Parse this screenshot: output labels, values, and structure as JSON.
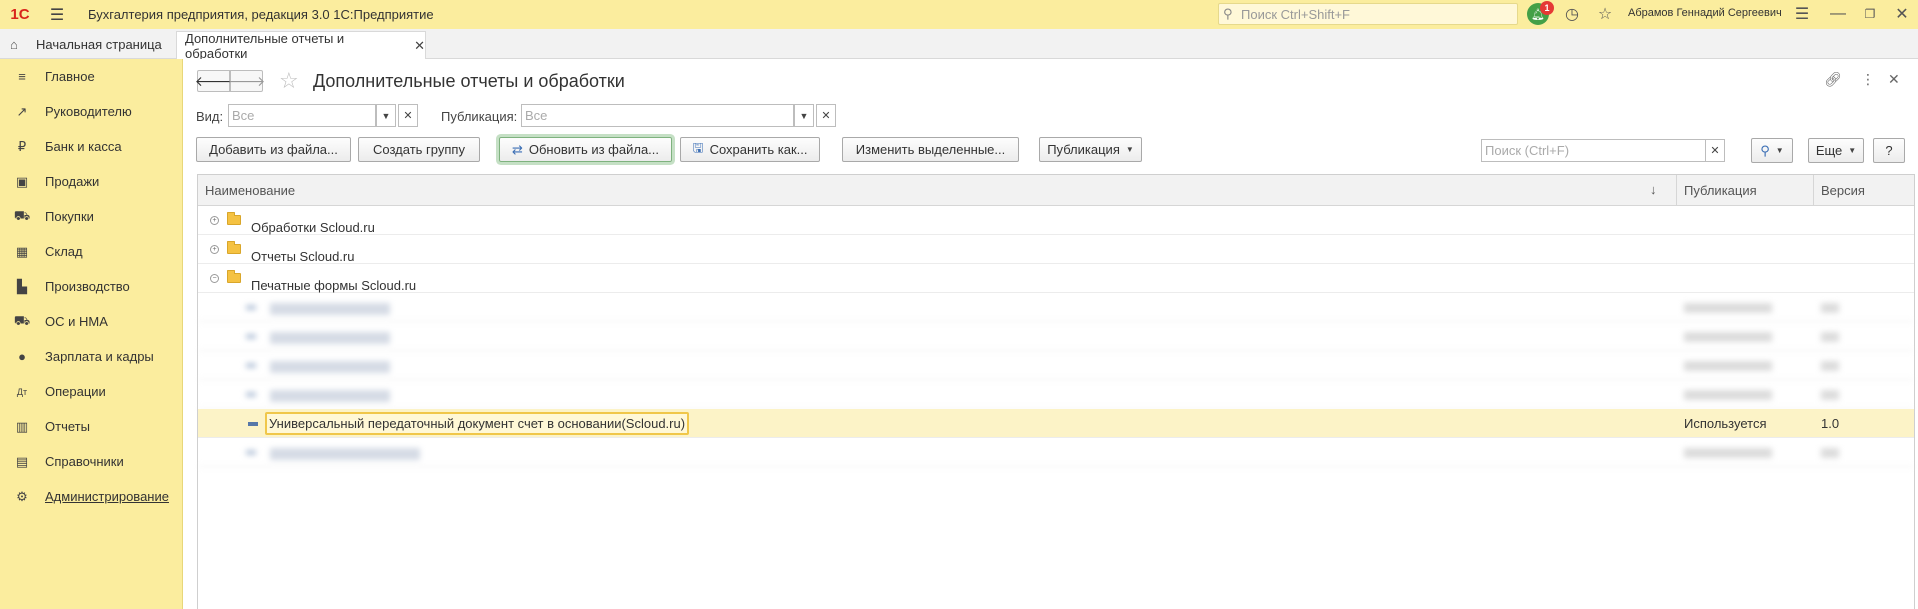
{
  "titlebar": {
    "logo": "1С",
    "app_title": "Бухгалтерия предприятия, редакция 3.0 1С:Предприятие",
    "search_placeholder": "Поиск Ctrl+Shift+F",
    "notifications_count": "1",
    "user_name": "Абрамов Геннадий Сергеевич"
  },
  "tabs": {
    "home": "Начальная страница",
    "active": "Дополнительные отчеты и обработки"
  },
  "sidebar": {
    "items": [
      {
        "label": "Главное",
        "icon": "menu-lines-icon"
      },
      {
        "label": "Руководителю",
        "icon": "trend-icon"
      },
      {
        "label": "Банк и касса",
        "icon": "ruble-coin-icon"
      },
      {
        "label": "Продажи",
        "icon": "shopping-bag-icon"
      },
      {
        "label": "Покупки",
        "icon": "cart-icon"
      },
      {
        "label": "Склад",
        "icon": "warehouse-icon"
      },
      {
        "label": "Производство",
        "icon": "factory-icon"
      },
      {
        "label": "ОС и НМА",
        "icon": "truck-icon"
      },
      {
        "label": "Зарплата и кадры",
        "icon": "person-icon"
      },
      {
        "label": "Операции",
        "icon": "dt-kt-icon"
      },
      {
        "label": "Отчеты",
        "icon": "bar-chart-icon"
      },
      {
        "label": "Справочники",
        "icon": "books-icon"
      },
      {
        "label": "Администрирование",
        "icon": "gear-icon"
      }
    ]
  },
  "page": {
    "title": "Дополнительные отчеты и обработки",
    "filters": {
      "kind_label": "Вид:",
      "kind_placeholder": "Все",
      "publication_label": "Публикация:",
      "publication_placeholder": "Все"
    },
    "toolbar": {
      "add_from_file": "Добавить из файла...",
      "create_group": "Создать группу",
      "update_from_file": "Обновить из файла...",
      "save_as": "Сохранить как...",
      "change_selected": "Изменить выделенные...",
      "publication": "Публикация",
      "search_placeholder": "Поиск (Ctrl+F)",
      "more": "Еще",
      "help": "?"
    },
    "table": {
      "columns": {
        "name": "Наименование",
        "publication": "Публикация",
        "version": "Версия"
      },
      "groups": [
        {
          "name": "Обработки Scloud.ru",
          "expander": "+"
        },
        {
          "name": "Отчеты Scloud.ru",
          "expander": "+"
        },
        {
          "name": "Печатные формы Scloud.ru",
          "expander": "−"
        }
      ],
      "selected_row": {
        "name": "Универсальный передаточный документ счет в основании(Scloud.ru)",
        "publication": "Используется",
        "version": "1.0"
      }
    }
  }
}
